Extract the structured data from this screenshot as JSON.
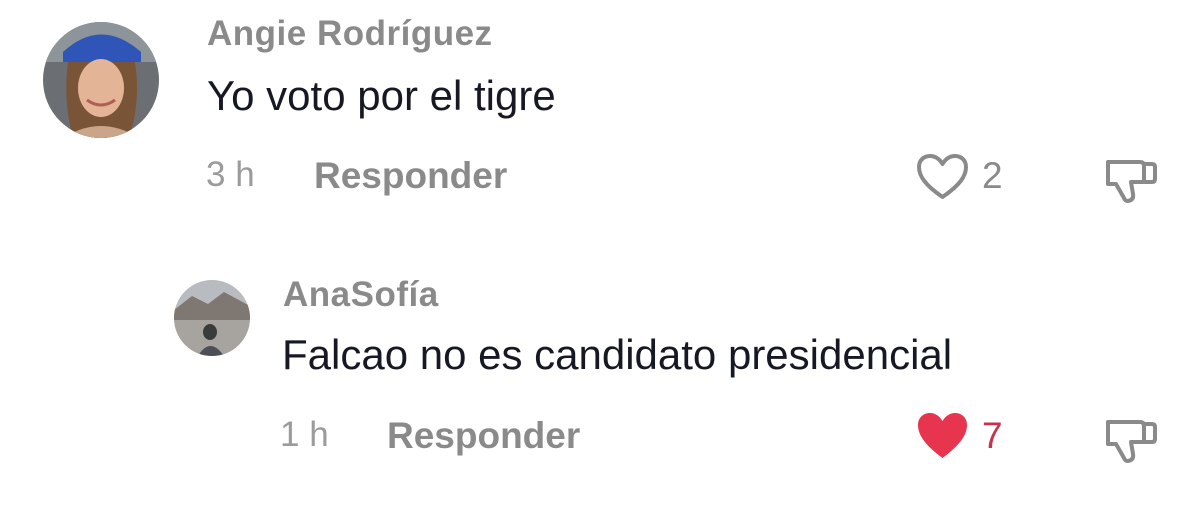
{
  "comments": [
    {
      "username": "Angie Rodríguez",
      "text": "Yo voto por el tigre",
      "time": "3 h",
      "reply_label": "Responder",
      "likes": "2",
      "liked": false,
      "like_icon": "heart-outline-icon",
      "dislike_icon": "thumbs-down-icon"
    },
    {
      "username": "AnaSofía",
      "text": "Falcao no es candidato presidencial",
      "time": "1 h",
      "reply_label": "Responder",
      "likes": "7",
      "liked": true,
      "like_icon": "heart-filled-icon",
      "dislike_icon": "thumbs-down-icon"
    }
  ],
  "colors": {
    "liked_heart": "#e8354f",
    "liked_count": "#c9324d",
    "muted_text": "#8a8a8a",
    "body_text": "#161823",
    "icon_outline": "#8a8a8a"
  }
}
